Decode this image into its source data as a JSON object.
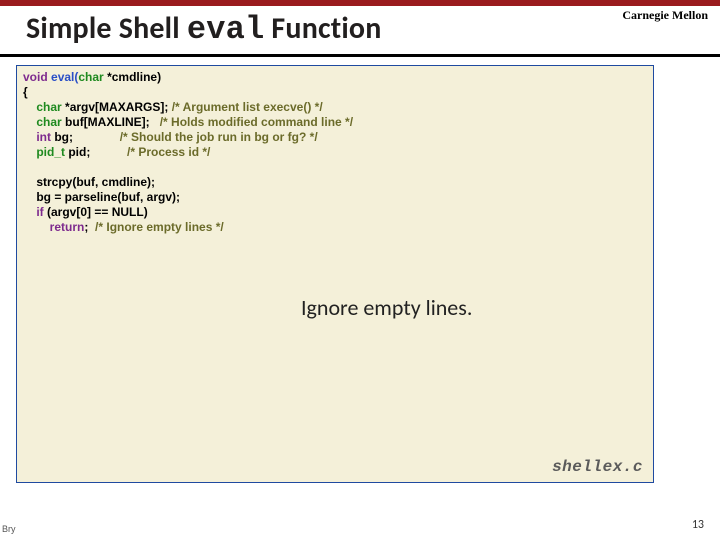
{
  "header": {
    "university": "Carnegie Mellon",
    "title_pre": "Simple Shell ",
    "title_mono": "eval",
    "title_post": " Function"
  },
  "code": {
    "l1_void": "void ",
    "l1_fn": "eval(",
    "l1_char": "char ",
    "l1_rest": "*cmdline)",
    "l2": "{",
    "l3_pre": "    ",
    "l3_char": "char ",
    "l3_var": "*argv[MAXARGS]; ",
    "l3_cmt": "/* Argument list execve() */",
    "l4_pre": "    ",
    "l4_char": "char ",
    "l4_var": "buf[MAXLINE];   ",
    "l4_cmt": "/* Holds modified command line */",
    "l5_pre": "    ",
    "l5_int": "int ",
    "l5_var": "bg;              ",
    "l5_cmt": "/* Should the job run in bg or fg? */",
    "l6_pre": "    ",
    "l6_pid": "pid_t ",
    "l6_var": "pid;           ",
    "l6_cmt": "/* Process id */",
    "blank1": "",
    "l8": "    strcpy(buf, cmdline);",
    "l9": "    bg = parseline(buf, argv);",
    "l10_pre": "    ",
    "l10_if": "if ",
    "l10_rest": "(argv[0] == NULL)",
    "l11_pre": "        ",
    "l11_ret": "return",
    "l11_semi": ";  ",
    "l11_cmt": "/* Ignore empty lines */"
  },
  "callout": "Ignore empty lines.",
  "srcfile": "shellex.c",
  "pagenum": "13",
  "footleft": "Bry"
}
